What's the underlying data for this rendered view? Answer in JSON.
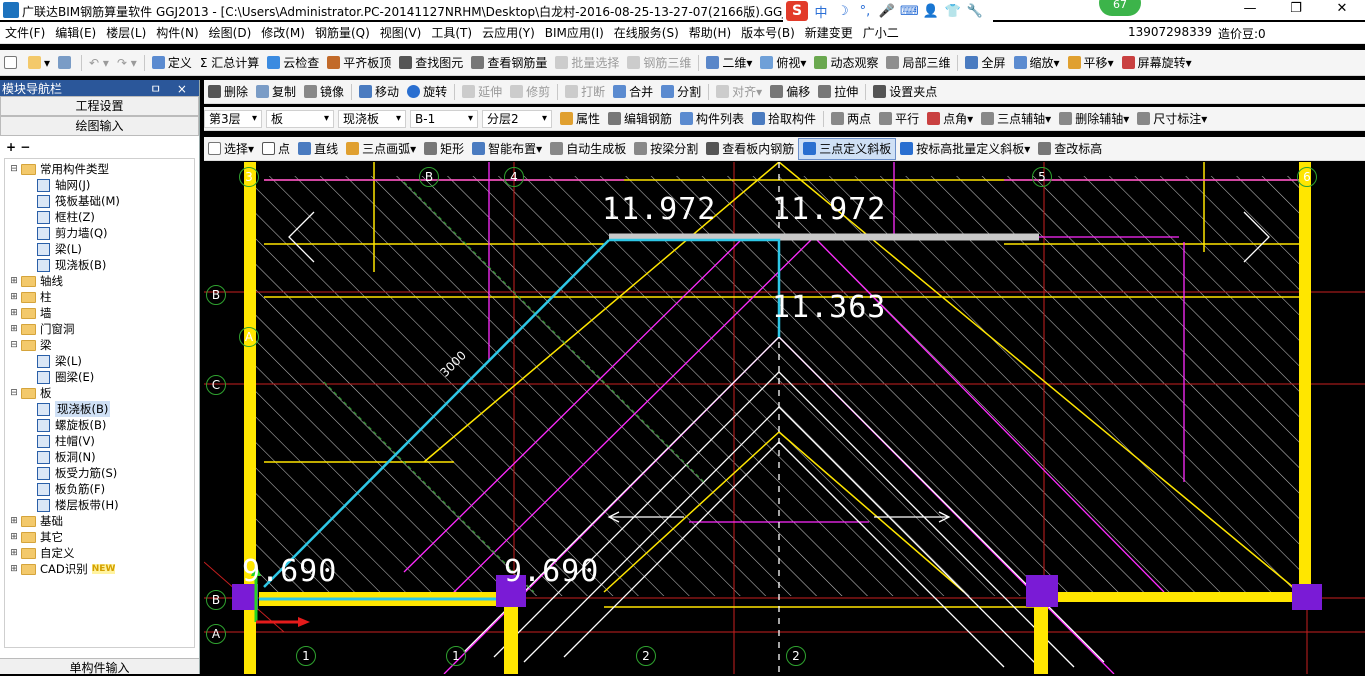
{
  "titlebar": {
    "title": "广联达BIM钢筋算量软件 GGJ2013 - [C:\\Users\\Administrator.PC-20141127NRHM\\Desktop\\白龙村-2016-08-25-13-27-07(2166版).GGJ1",
    "badge": "67",
    "ime": [
      "中",
      "☽",
      "°,",
      "🎤",
      "⌨",
      "👤",
      "👕",
      "🔧"
    ]
  },
  "menubar": {
    "items": [
      "文件(F)",
      "编辑(E)",
      "楼层(L)",
      "构件(N)",
      "绘图(D)",
      "修改(M)",
      "钢筋量(Q)",
      "视图(V)",
      "工具(T)",
      "云应用(Y)",
      "BIM应用(I)",
      "在线服务(S)",
      "帮助(H)",
      "版本号(B)",
      "新建变更",
      "广小二"
    ],
    "account": "13907298339",
    "bean": "造价豆:0"
  },
  "toolbar1": {
    "items": [
      "定义",
      "Σ 汇总计算",
      "云检查",
      "平齐板顶",
      "查找图元",
      "查看钢筋量",
      "批量选择",
      "钢筋三维",
      "二维",
      "俯视",
      "动态观察",
      "局部三维",
      "全屏",
      "缩放",
      "平移",
      "屏幕旋转"
    ]
  },
  "toolbar2": {
    "items": [
      "删除",
      "复制",
      "镜像",
      "移动",
      "旋转",
      "延伸",
      "修剪",
      "打断",
      "合并",
      "分割",
      "对齐",
      "偏移",
      "拉伸",
      "设置夹点"
    ]
  },
  "toolbar3": {
    "floor": "第3层",
    "type": "板",
    "subtype": "现浇板",
    "name": "B-1",
    "layer": "分层2",
    "items": [
      "属性",
      "编辑钢筋",
      "构件列表",
      "拾取构件",
      "两点",
      "平行",
      "点角",
      "三点辅轴",
      "删除辅轴",
      "尺寸标注"
    ]
  },
  "toolbar4": {
    "items": [
      "选择",
      "点",
      "直线",
      "三点画弧",
      "矩形",
      "智能布置",
      "自动生成板",
      "按梁分割",
      "查看板内钢筋",
      "三点定义斜板",
      "按标高批量定义斜板",
      "查改标高"
    ]
  },
  "nav": {
    "title": "模块导航栏",
    "pin": "ㅁ ×",
    "project_settings": "工程设置",
    "drawing_input": "绘图输入",
    "tools": "+ −",
    "footer": "单构件输入",
    "tree": [
      {
        "label": "常用构件类型",
        "level": 0,
        "toggle": "⊟",
        "kind": "folder"
      },
      {
        "label": "轴网(J)",
        "level": 1,
        "kind": "item"
      },
      {
        "label": "筏板基础(M)",
        "level": 1,
        "kind": "item"
      },
      {
        "label": "框柱(Z)",
        "level": 1,
        "kind": "item"
      },
      {
        "label": "剪力墙(Q)",
        "level": 1,
        "kind": "item"
      },
      {
        "label": "梁(L)",
        "level": 1,
        "kind": "item"
      },
      {
        "label": "现浇板(B)",
        "level": 1,
        "kind": "item"
      },
      {
        "label": "轴线",
        "level": 0,
        "toggle": "⊞",
        "kind": "folder"
      },
      {
        "label": "柱",
        "level": 0,
        "toggle": "⊞",
        "kind": "folder"
      },
      {
        "label": "墙",
        "level": 0,
        "toggle": "⊞",
        "kind": "folder"
      },
      {
        "label": "门窗洞",
        "level": 0,
        "toggle": "⊞",
        "kind": "folder"
      },
      {
        "label": "梁",
        "level": 0,
        "toggle": "⊟",
        "kind": "folder"
      },
      {
        "label": "梁(L)",
        "level": 1,
        "kind": "item"
      },
      {
        "label": "圈梁(E)",
        "level": 1,
        "kind": "item"
      },
      {
        "label": "板",
        "level": 0,
        "toggle": "⊟",
        "kind": "folder"
      },
      {
        "label": "现浇板(B)",
        "level": 1,
        "kind": "item",
        "selected": true
      },
      {
        "label": "螺旋板(B)",
        "level": 1,
        "kind": "item"
      },
      {
        "label": "柱帽(V)",
        "level": 1,
        "kind": "item"
      },
      {
        "label": "板洞(N)",
        "level": 1,
        "kind": "item"
      },
      {
        "label": "板受力筋(S)",
        "level": 1,
        "kind": "item"
      },
      {
        "label": "板负筋(F)",
        "level": 1,
        "kind": "item"
      },
      {
        "label": "楼层板带(H)",
        "level": 1,
        "kind": "item"
      },
      {
        "label": "基础",
        "level": 0,
        "toggle": "⊞",
        "kind": "folder"
      },
      {
        "label": "其它",
        "level": 0,
        "toggle": "⊞",
        "kind": "folder"
      },
      {
        "label": "自定义",
        "level": 0,
        "toggle": "⊞",
        "kind": "folder"
      },
      {
        "label": "CAD识别",
        "level": 0,
        "toggle": "⊞",
        "kind": "folder",
        "badge": "NEW"
      }
    ]
  },
  "canvas": {
    "elevations": [
      "11.972",
      "11.972",
      "11.363",
      "9.690",
      "9.690"
    ],
    "dim": "3000",
    "axis_left": [
      "B",
      "A",
      "C",
      "B",
      "A"
    ],
    "axis_top": [
      "3",
      "B",
      "4",
      "5",
      "6"
    ],
    "axis_bottom": [
      "1",
      "1",
      "2",
      "2"
    ]
  }
}
